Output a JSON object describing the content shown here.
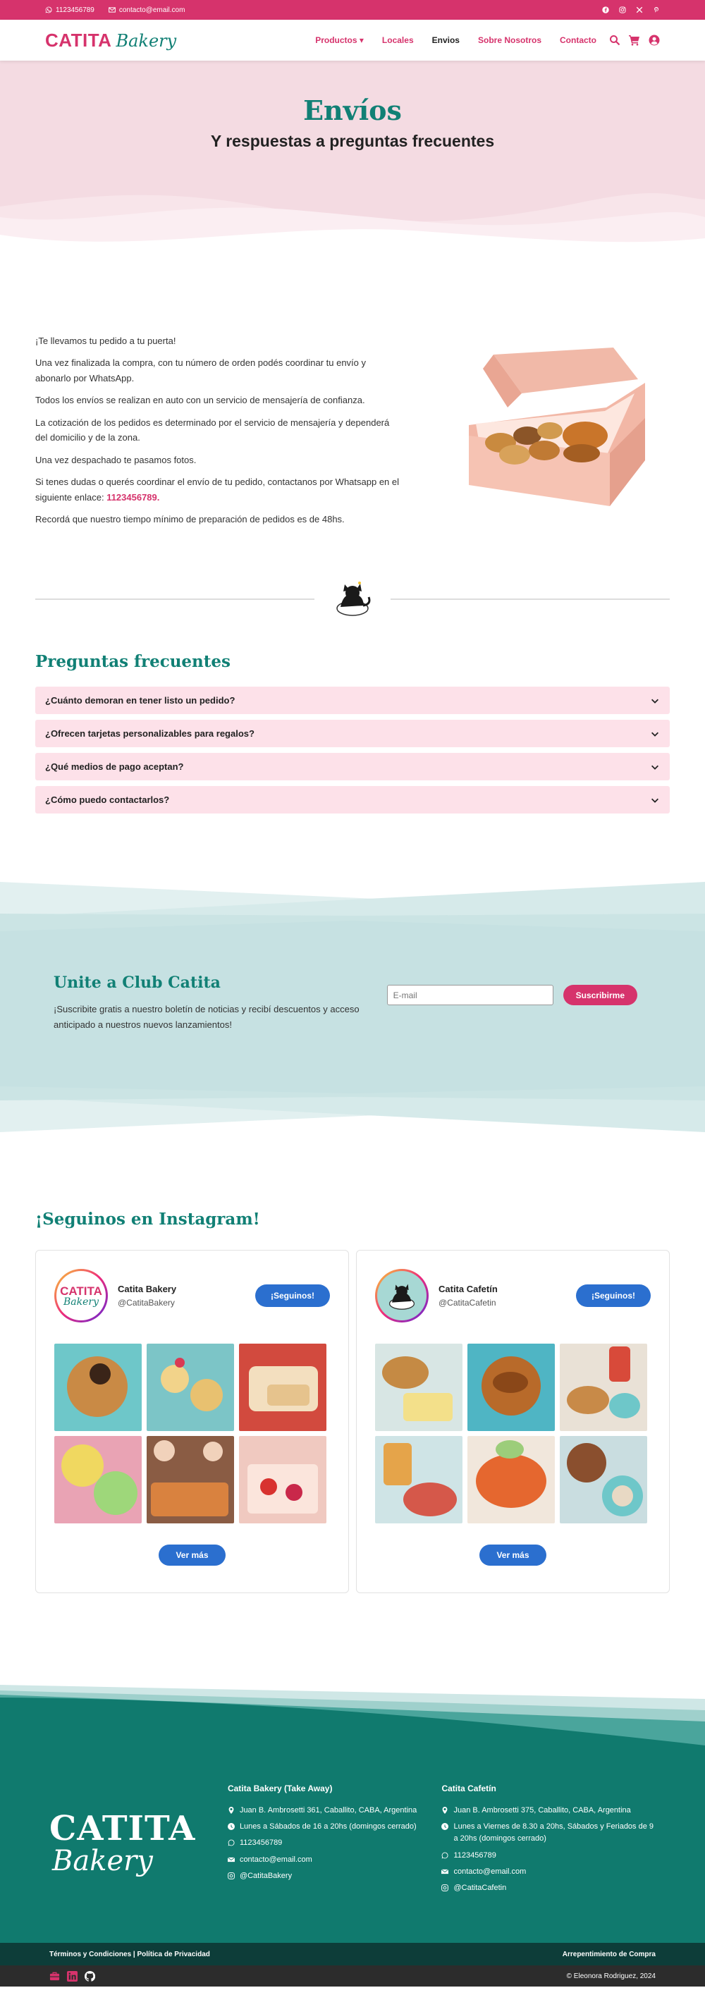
{
  "topbar": {
    "phone": "1123456789",
    "email": "contacto@email.com",
    "social": [
      "facebook-icon",
      "instagram-icon",
      "x-icon",
      "pinterest-icon"
    ]
  },
  "nav": {
    "logo_part1": "CATITA",
    "logo_part2": "Bakery",
    "products": "Productos",
    "locales": "Locales",
    "envios": "Envios",
    "about": "Sobre Nosotros",
    "contact": "Contacto"
  },
  "hero": {
    "title": "Envíos",
    "subtitle": "Y respuestas a preguntas frecuentes"
  },
  "envios": {
    "p1": "¡Te llevamos tu pedido a tu puerta!",
    "p2": "Una vez finalizada la compra, con tu número de orden podés coordinar tu envío y abonarlo por WhatsApp.",
    "p3": "Todos los envíos se realizan en auto con un servicio de mensajería de confianza.",
    "p4": "La cotización de los pedidos es determinado por el servicio de mensajería y dependerá del domicilio y de la zona.",
    "p5": "Una vez despachado te pasamos fotos.",
    "p6": "Si tenes dudas o querés coordinar el envío de tu pedido, contactanos por Whatsapp en el siguiente enlace: ",
    "p6_phone": "1123456789.",
    "p7": "Recordá que nuestro tiempo mínimo de preparación de pedidos es de 48hs."
  },
  "faq": {
    "title": "Preguntas frecuentes",
    "items": [
      {
        "q": "¿Cuánto demoran en tener listo un pedido?"
      },
      {
        "q": "¿Ofrecen tarjetas personalizables para regalos?"
      },
      {
        "q": "¿Qué medios de pago aceptan?"
      },
      {
        "q": "¿Cómo puedo contactarlos?"
      }
    ]
  },
  "newsletter": {
    "title": "Unite a Club Catita",
    "text": "¡Suscribite gratis a nuestro boletín de noticias y recibí descuentos y acceso anticipado a nuestros nuevos lanzamientos!",
    "placeholder": "E-mail",
    "button": "Suscribirme"
  },
  "instagram": {
    "title": "¡Seguinos en Instagram!",
    "cards": [
      {
        "avatar_line1": "CATITA",
        "avatar_line2": "Bakery",
        "name": "Catita Bakery",
        "handle": "@CatitaBakery",
        "follow": "¡Seguinos!",
        "more": "Ver más"
      },
      {
        "name": "Catita Cafetín",
        "handle": "@CatitaCafetin",
        "follow": "¡Seguinos!",
        "more": "Ver más"
      }
    ]
  },
  "footer": {
    "logo_part1": "CATITA",
    "logo_part2": "Bakery",
    "col1": {
      "title": "Catita Bakery (Take Away)",
      "address": "Juan B. Ambrosetti 361, Caballito, CABA, Argentina",
      "hours": "Lunes a Sábados de 16 a 20hs (domingos cerrado)",
      "phone": "1123456789",
      "email": "contacto@email.com",
      "instagram": "@CatitaBakery"
    },
    "col2": {
      "title": "Catita Cafetín",
      "address": "Juan B. Ambrosetti 375, Caballito, CABA, Argentina",
      "hours": "Lunes a Viernes de 8.30 a 20hs, Sábados y Feriados de 9 a 20hs (domingos cerrado)",
      "phone": "1123456789",
      "email": "contacto@email.com",
      "instagram": "@CatitaCafetin"
    },
    "legal": "Términos y Condiciones | Política de Privacidad",
    "refund": "Arrepentimiento de Compra",
    "copyright": "© Eleonora Rodriguez, 2024"
  },
  "colors": {
    "pink": "#d6336c",
    "teal": "#118075",
    "light_pink": "#fde1e9",
    "blue": "#2b6fcf"
  }
}
